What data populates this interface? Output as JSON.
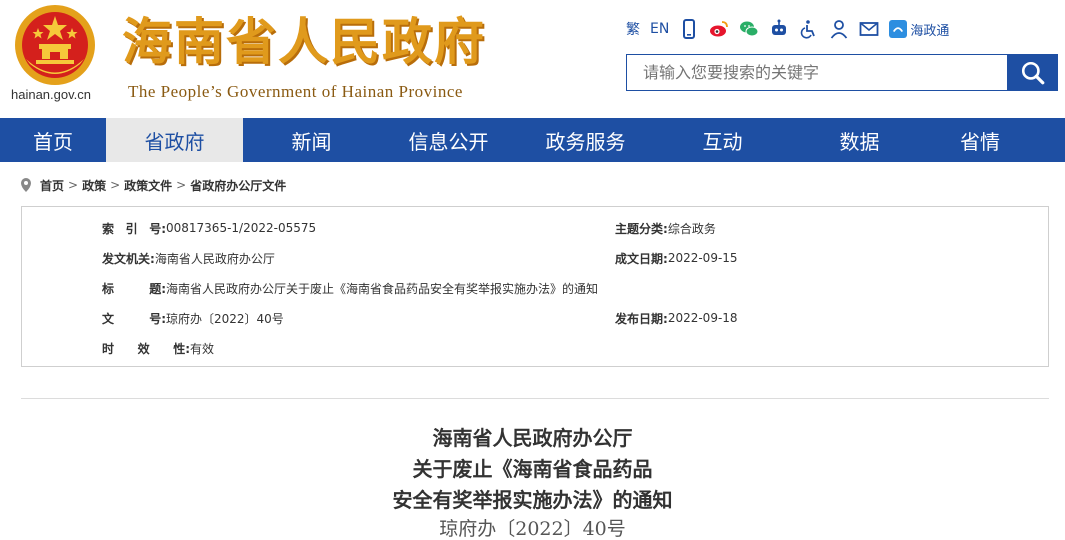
{
  "header": {
    "logo_cn": "海南省人民政府",
    "logo_en": "The People’s Government  of Hainan Province",
    "domain": "hainan.gov.cn",
    "toolbar": {
      "traditional": "繁",
      "english": "EN",
      "hzt_label": "海政通"
    },
    "search": {
      "placeholder": "请输入您要搜索的关键字"
    }
  },
  "nav": {
    "items": [
      "首页",
      "省政府",
      "新闻",
      "信息公开",
      "政务服务",
      "互动",
      "数据",
      "省情"
    ],
    "active_index": 1
  },
  "breadcrumb": [
    "首页",
    "政策",
    "政策文件",
    "省政府办公厅文件"
  ],
  "info": {
    "index_label_chars": [
      "索",
      "引",
      "号:"
    ],
    "index_value": "00817365-1/2022-05575",
    "category_label": "主题分类:",
    "category_value": "综合政务",
    "issuer_label": "发文机关:",
    "issuer_value": "海南省人民政府办公厅",
    "created_label": "成文日期:",
    "created_value": "2022-09-15",
    "title_label_chars": [
      "标",
      "题:"
    ],
    "title_value": "海南省人民政府办公厅关于废止《海南省食品药品安全有奖举报实施办法》的通知",
    "docno_label_chars": [
      "文",
      "号:"
    ],
    "docno_value": "琼府办〔2022〕40号",
    "published_label": "发布日期:",
    "published_value": "2022-09-18",
    "validity_label_chars": [
      "时",
      "效",
      "性:"
    ],
    "validity_value": "有效"
  },
  "document": {
    "title_lines": [
      "海南省人民政府办公厅",
      "关于废止《海南省食品药品",
      "安全有奖举报实施办法》的通知"
    ],
    "number": "琼府办〔2022〕40号"
  },
  "colors": {
    "nav_blue": "#1e4fa3",
    "logo_gold": "#e09a1c",
    "emblem_red": "#d4201c"
  }
}
